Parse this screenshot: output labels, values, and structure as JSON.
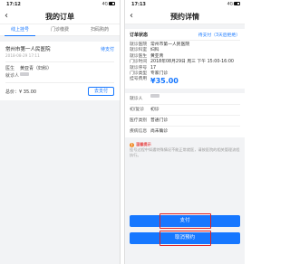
{
  "left": {
    "status_time": "17:12",
    "network": "4G",
    "title": "我的订单",
    "tabs": [
      {
        "label": "线上挂号",
        "active": true
      },
      {
        "label": "门诊缴费",
        "active": false
      },
      {
        "label": "扫码购药",
        "active": false
      }
    ],
    "order": {
      "hospital": "常州市第一人民医院",
      "time": "2018-08-29 17:11",
      "status": "待支付",
      "doctor_label": "医生",
      "doctor": "黄亚青（妇科）",
      "patient_label": "就诊人",
      "price": "总价：¥ 35.00",
      "pay_button": "去支付"
    }
  },
  "right": {
    "status_time": "17:13",
    "network": "4G",
    "title": "预约详情",
    "order_status_label": "订单状态",
    "order_status_value": "待支付（3天后拒绝）",
    "details": [
      {
        "label": "就诊医院",
        "value": "常州市第一人民医院"
      },
      {
        "label": "就诊科室",
        "value": "妇科"
      },
      {
        "label": "就诊医生",
        "value": "黄亚青"
      },
      {
        "label": "门诊时间",
        "value": "2018年08月29日 周三 下午 15:00-16:00"
      },
      {
        "label": "就诊序号",
        "value": "17"
      },
      {
        "label": "门诊类型",
        "value": "专家门诊"
      },
      {
        "label": "挂号费用",
        "value": "¥35.00"
      }
    ],
    "patient": [
      {
        "label": "就诊人",
        "value": ""
      },
      {
        "label": "初/复诊",
        "value": "初诊"
      },
      {
        "label": "医疗类别",
        "value": "普通门诊"
      },
      {
        "label": "疾病信息",
        "value": "尚未确诊"
      }
    ],
    "tips_title": "温馨提示",
    "tips_body": "挂号过程中如遇特殊情况不能正常就医，请按医院的相关管理流程执行。",
    "pay_button": "支付",
    "cancel_button": "取消预约"
  },
  "colors": {
    "accent": "#1677ff",
    "highlight": "#e02020",
    "warning": "#e64c4c"
  }
}
